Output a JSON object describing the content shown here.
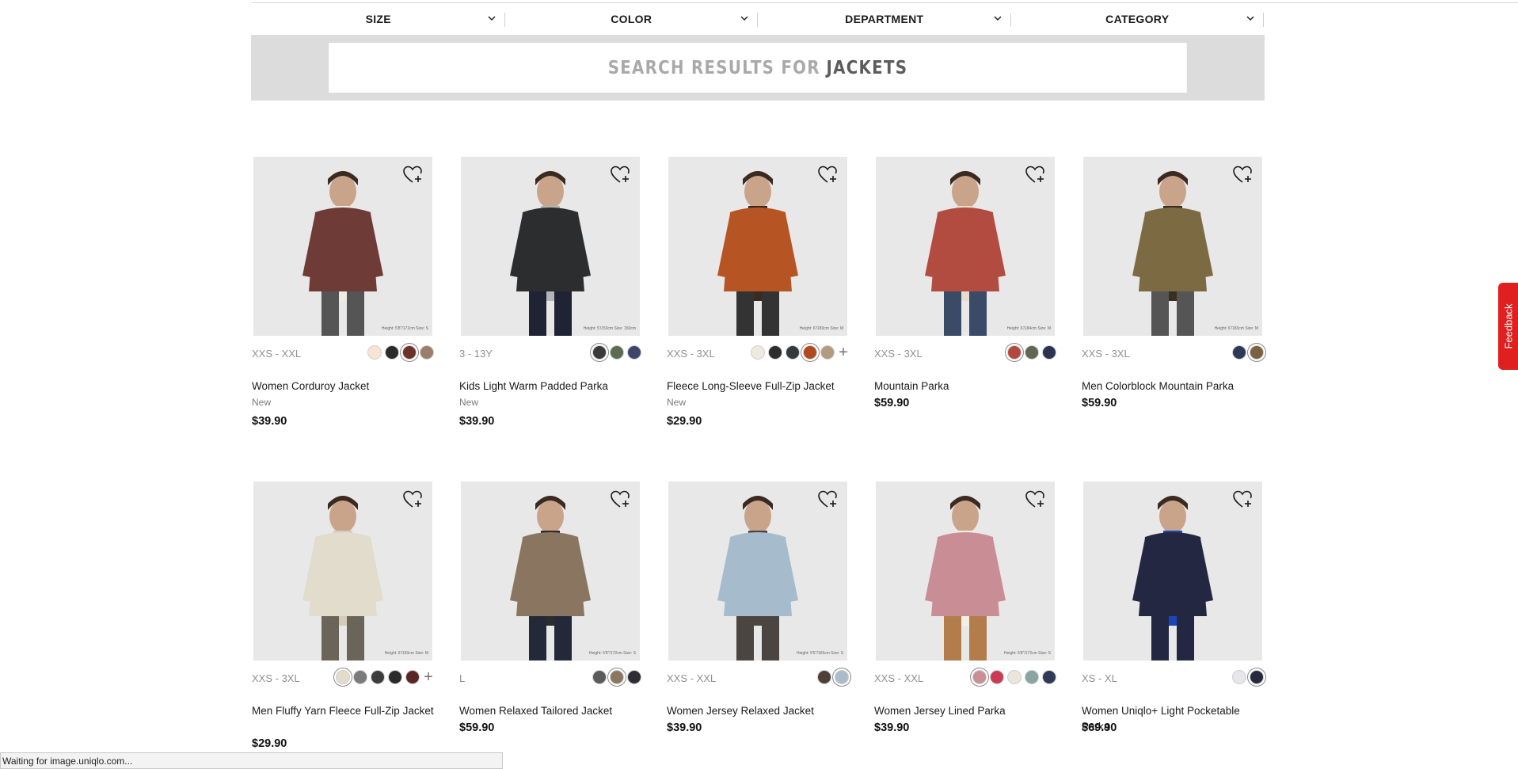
{
  "filters": [
    {
      "label": "SIZE"
    },
    {
      "label": "COLOR"
    },
    {
      "label": "DEPARTMENT"
    },
    {
      "label": "CATEGORY"
    }
  ],
  "search": {
    "prefix": "SEARCH RESULTS FOR",
    "keyword": "JACKETS"
  },
  "products": [
    {
      "name": "Women Corduroy Jacket",
      "sizes": "XXS - XXL",
      "tag": "New",
      "price": "$39.90",
      "info": "Height: 5'8\"/172cm Size: S",
      "swatches": [
        "#f7e4d3",
        "#2b2b2b",
        "#6e3129",
        "#9c7d6a"
      ],
      "selected": 2,
      "more": false,
      "garment": "#6f3b36",
      "inner": "#f0ebe2",
      "pants": "#555"
    },
    {
      "name": "Kids Light Warm Padded Parka",
      "sizes": "3 - 13Y",
      "tag": "New",
      "price": "$39.90",
      "info": "Height: 5'/153cm Size: 150cm",
      "swatches": [
        "#3a3a3a",
        "#5d6b4f",
        "#3b466e"
      ],
      "selected": 0,
      "more": false,
      "garment": "#2c2d2f",
      "inner": "#b5b5b5",
      "pants": "#1f2333"
    },
    {
      "name": "Fleece Long-Sleeve Full-Zip Jacket",
      "sizes": "XXS - 3XL",
      "tag": "New",
      "price": "$29.90",
      "info": "Height: 6'/183cm Size: M",
      "swatches": [
        "#efe9df",
        "#2c2c2c",
        "#36383d",
        "#b1481f",
        "#b19a7e"
      ],
      "selected": 3,
      "more": true,
      "garment": "#b75424",
      "inner": "#3b2a22",
      "pants": "#333"
    },
    {
      "name": "Mountain Parka",
      "sizes": "XXS - 3XL",
      "tag": "",
      "price": "$59.90",
      "info": "Height: 6'/184cm Size: M",
      "swatches": [
        "#b5483d",
        "#5f6651",
        "#2a3350"
      ],
      "selected": 0,
      "more": false,
      "garment": "#b24c40",
      "inner": "#e5ddd0",
      "pants": "#3b4a66"
    },
    {
      "name": "Men Colorblock Mountain Parka",
      "sizes": "XXS - 3XL",
      "tag": "",
      "price": "$59.90",
      "info": "Height: 6'/183cm Size: M",
      "swatches": [
        "#2d3a57",
        "#7a6140"
      ],
      "selected": 1,
      "more": false,
      "garment": "#7c6a43",
      "inner": "#3a2d21",
      "pants": "#555"
    },
    {
      "name": "Men Fluffy Yarn Fleece Full-Zip Jacket",
      "sizes": "XXS - 3XL",
      "tag": "",
      "price": "$29.90",
      "info": "Height: 6'/183cm Size: M",
      "swatches": [
        "#e4dccb",
        "#7b7b7b",
        "#3c3c3c",
        "#2b2b2b",
        "#5c2525"
      ],
      "selected": 0,
      "more": true,
      "garment": "#e2dccd",
      "inner": "#d4ccbb",
      "pants": "#6b6559"
    },
    {
      "name": "Women Relaxed Tailored Jacket",
      "sizes": "L",
      "tag": "",
      "price": "$59.90",
      "info": "Height: 5'8\"/172cm Size: S",
      "swatches": [
        "#5b5b5b",
        "#8a7760",
        "#2d2d33"
      ],
      "selected": 1,
      "more": false,
      "garment": "#8a7560",
      "inner": "#2c2c2c",
      "pants": "#24293a"
    },
    {
      "name": "Women Jersey Relaxed Jacket",
      "sizes": "XXS - XXL",
      "tag": "",
      "price": "$39.90",
      "info": "Height: 5'5\"/165cm Size: S",
      "swatches": [
        "#4f4036",
        "#a9bccc"
      ],
      "selected": 1,
      "more": false,
      "garment": "#a6bccd",
      "inner": "#4a4540",
      "pants": "#4a4540"
    },
    {
      "name": "Women Jersey Lined Parka",
      "sizes": "XXS - XXL",
      "tag": "",
      "price": "$39.90",
      "info": "Height: 5'8\"/172cm Size: S",
      "swatches": [
        "#c89096",
        "#c93b55",
        "#ece5dc",
        "#8aa3a3",
        "#2f3a57"
      ],
      "selected": 0,
      "more": false,
      "garment": "#c98e95",
      "inner": "#f4eee6",
      "pants": "#b37d4b"
    },
    {
      "name": "Women Uniqlo+ Light Pocketable Parka",
      "sizes": "XS - XL",
      "tag": "",
      "price": "$69.90",
      "info": "",
      "swatches": [
        "#e7e7e9",
        "#272a3c"
      ],
      "selected": 1,
      "more": false,
      "garment": "#242741",
      "inner": "#1b46b8",
      "pants": "#242741"
    }
  ],
  "feedback": {
    "label": "Feedback"
  },
  "status": {
    "text": "Waiting for image.uniqlo.com..."
  }
}
